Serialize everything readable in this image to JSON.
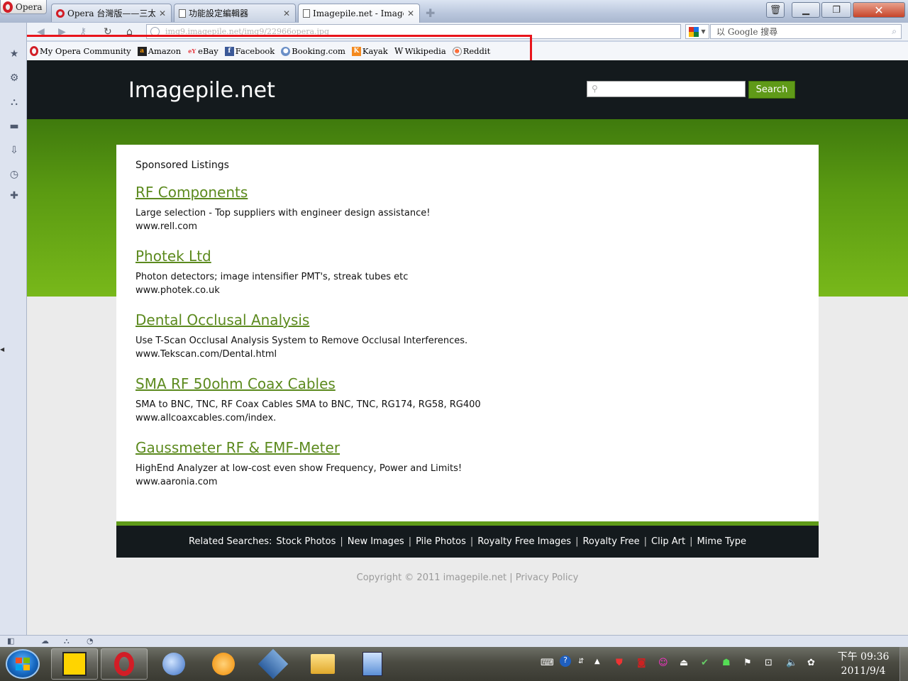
{
  "browser": {
    "menu_label": "Opera",
    "tabs": [
      {
        "title": "Opera 台灣版——三太...",
        "icon": "opera-icon",
        "active": false
      },
      {
        "title": "功能設定編輯器",
        "icon": "page-icon",
        "active": false
      },
      {
        "title": "Imagepile.net - Imagepile...",
        "icon": "page-icon",
        "active": true
      }
    ],
    "address": "img9.imagepile.net/img9/22966opera.jpg",
    "search_placeholder": "以 Google 搜尋",
    "bookmarks": [
      {
        "label": "My Opera Community",
        "icon": "opera-icon"
      },
      {
        "label": "Amazon",
        "icon": "amazon-icon"
      },
      {
        "label": "eBay",
        "icon": "ebay-icon"
      },
      {
        "label": "Facebook",
        "icon": "facebook-icon"
      },
      {
        "label": "Booking.com",
        "icon": "booking-icon"
      },
      {
        "label": "Kayak",
        "icon": "kayak-icon"
      },
      {
        "label": "Wikipedia",
        "icon": "wikipedia-icon"
      },
      {
        "label": "Reddit",
        "icon": "reddit-icon"
      }
    ],
    "highlight_color": "#e8141b"
  },
  "site": {
    "title": "Imagepile.net",
    "search_button": "Search",
    "sponsored_heading": "Sponsored Listings",
    "listings": [
      {
        "title": "RF Components",
        "desc": "Large selection - Top suppliers with engineer design assistance!",
        "url": "www.rell.com"
      },
      {
        "title": "Photek Ltd",
        "desc": "Photon detectors; image intensifier PMT's, streak tubes etc",
        "url": "www.photek.co.uk"
      },
      {
        "title": "Dental Occlusal Analysis",
        "desc": "Use T-Scan Occlusal Analysis System to Remove Occlusal Interferences.",
        "url": "www.Tekscan.com/Dental.html"
      },
      {
        "title": "SMA RF 50ohm Coax Cables",
        "desc": "SMA to BNC, TNC, RF Coax Cables SMA to BNC, TNC, RG174, RG58, RG400",
        "url": "www.allcoaxcables.com/index."
      },
      {
        "title": "Gaussmeter RF & EMF-Meter",
        "desc": "HighEnd Analyzer at low-cost even show Frequency, Power and Limits!",
        "url": "www.aaronia.com"
      }
    ],
    "related_label": "Related Searches:",
    "related_links": [
      "Stock Photos",
      "New Images",
      "Pile Photos",
      "Royalty Free Images",
      "Royalty Free",
      "Clip Art",
      "Mime Type"
    ],
    "copyright": "Copyright © 2011 imagepile.net",
    "privacy": "Privacy Policy",
    "accent_green": "#5f9a18",
    "link_green": "#5c8a1e"
  },
  "taskbar": {
    "time": "下午 09:36",
    "date": "2011/9/4"
  }
}
